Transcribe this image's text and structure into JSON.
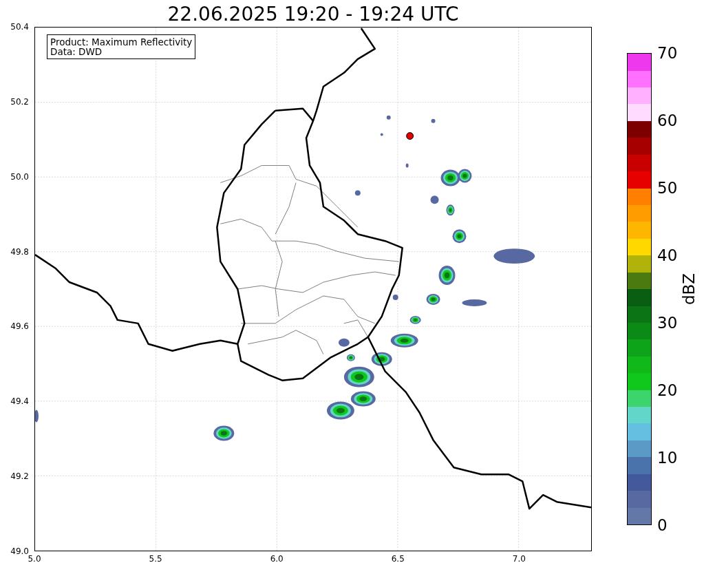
{
  "title": "22.06.2025 19:20 - 19:24 UTC",
  "info_box": {
    "lines": [
      "Product: Maximum Reflectivity",
      "Data: DWD"
    ]
  },
  "map": {
    "x_ticks": [
      "5.0",
      "5.5",
      "6.0",
      "6.5",
      "7.0"
    ],
    "y_ticks": [
      "50.4",
      "50.2",
      "50.0",
      "49.8",
      "49.6",
      "49.4",
      "49.2",
      "49.0"
    ]
  },
  "colorbar": {
    "label": "dBZ",
    "ticks": [
      "70",
      "60",
      "50",
      "40",
      "30",
      "20",
      "10",
      "0"
    ],
    "segments": [
      {
        "color": "#6478a8"
      },
      {
        "color": "#5868a0"
      },
      {
        "color": "#44599c"
      },
      {
        "color": "#4a73ac"
      },
      {
        "color": "#5b9ac6"
      },
      {
        "color": "#64bfe0"
      },
      {
        "color": "#62d6c8"
      },
      {
        "color": "#3cd46c"
      },
      {
        "color": "#10c81c"
      },
      {
        "color": "#10b81a"
      },
      {
        "color": "#0ea41a"
      },
      {
        "color": "#0c8a16"
      },
      {
        "color": "#0b7414"
      },
      {
        "color": "#0a5e12"
      },
      {
        "color": "#4a7a10"
      },
      {
        "color": "#afb30a"
      },
      {
        "color": "#ffd800"
      },
      {
        "color": "#ffb600"
      },
      {
        "color": "#ff9d00"
      },
      {
        "color": "#ff7f00"
      },
      {
        "color": "#e60000"
      },
      {
        "color": "#c80000"
      },
      {
        "color": "#a60000"
      },
      {
        "color": "#7c0000"
      },
      {
        "color": "#ffdcff"
      },
      {
        "color": "#ffb0ff"
      },
      {
        "color": "#ff70ff"
      },
      {
        "color": "#ee38ee"
      }
    ]
  }
}
